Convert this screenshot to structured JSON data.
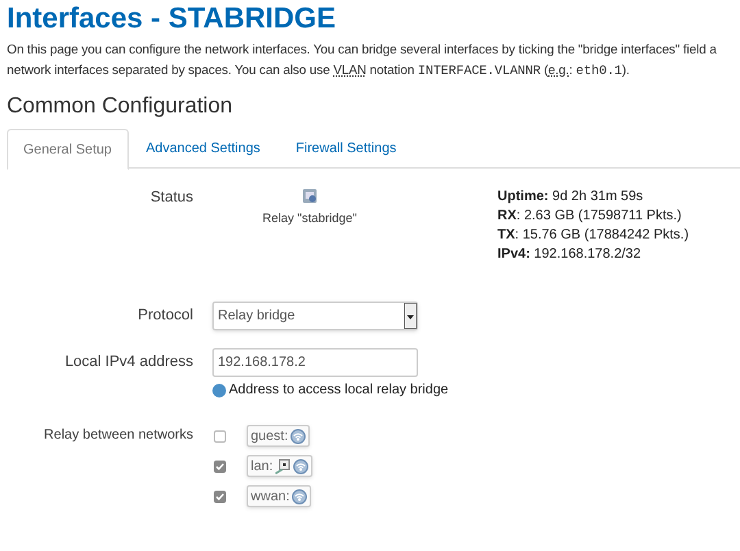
{
  "page_title": "Interfaces - STABRIDGE",
  "description": [
    {
      "kind": "text",
      "text": "On this page you can configure the network interfaces. You can bridge several interfaces by ticking the \"bridge interfaces\" field a"
    },
    {
      "kind": "break"
    },
    {
      "kind": "text",
      "text": "network interfaces separated by spaces. You can also use "
    },
    {
      "kind": "abbr",
      "text": "VLAN"
    },
    {
      "kind": "text",
      "text": " notation "
    },
    {
      "kind": "code",
      "text": "INTERFACE.VLANNR"
    },
    {
      "kind": "text",
      "text": " ("
    },
    {
      "kind": "abbr",
      "text": "e.g."
    },
    {
      "kind": "text",
      "text": ": "
    },
    {
      "kind": "code",
      "text": "eth0.1"
    },
    {
      "kind": "text",
      "text": ")."
    }
  ],
  "section_title": "Common Configuration",
  "tabs": [
    {
      "label": "General Setup",
      "selected": true
    },
    {
      "label": "Advanced Settings",
      "selected": false
    },
    {
      "label": "Firewall Settings",
      "selected": false
    }
  ],
  "status": {
    "label": "Status",
    "device": "Relay \"stabridge\"",
    "stats": [
      {
        "key": "Uptime:",
        "value": " 9d 2h 31m 59s"
      },
      {
        "key": "RX",
        "value": ": 2.63 GB (17598711 Pkts.)"
      },
      {
        "key": "TX",
        "value": ": 15.76 GB (17884242 Pkts.)"
      },
      {
        "key": "IPv4:",
        "value": " 192.168.178.2/32"
      }
    ]
  },
  "protocol": {
    "label": "Protocol",
    "value": "Relay bridge"
  },
  "local_ipv4": {
    "label": "Local IPv4 address",
    "value": "192.168.178.2",
    "hint": "Address to access local relay bridge"
  },
  "relay": {
    "label": "Relay between networks",
    "networks": [
      {
        "name": "guest:",
        "checked": false,
        "interfaces": [
          {
            "kind": "wireless"
          }
        ]
      },
      {
        "name": "lan:",
        "checked": true,
        "interfaces": [
          {
            "kind": "wired"
          },
          {
            "kind": "wireless"
          }
        ]
      },
      {
        "name": "wwan:",
        "checked": true,
        "interfaces": [
          {
            "kind": "wireless"
          }
        ]
      }
    ]
  }
}
